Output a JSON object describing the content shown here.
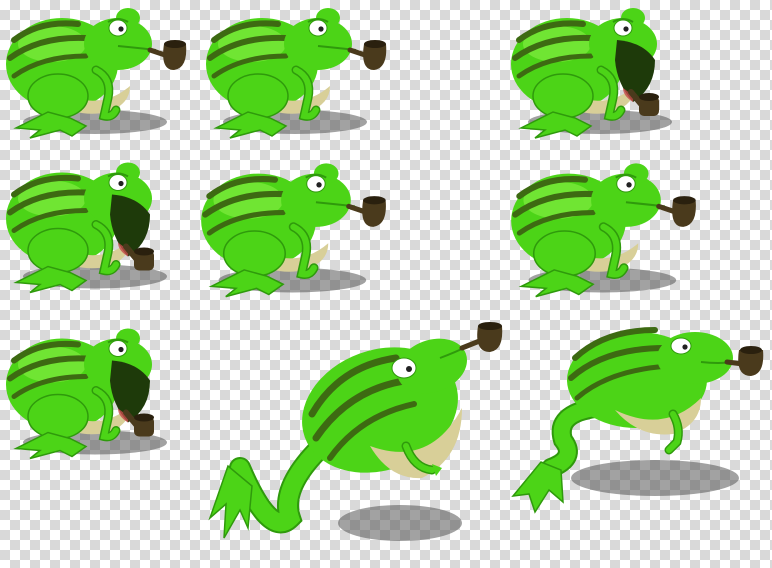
{
  "colors": {
    "skin": "#4cd417",
    "skin_light": "#8ef24a",
    "skin_dark": "#2f9a0c",
    "stripe": "#3d6a12",
    "belly": "#d8cf98",
    "belly_shade": "#b9ad72",
    "eye_white": "#ffffff",
    "pupil": "#222222",
    "mouth": "#1e3a0a",
    "pipe": "#4a3a1c",
    "pipe_rim": "#2a200e",
    "shadow": "#555555"
  },
  "sprites": [
    {
      "name": "sitting-frog-pipe-mouth",
      "pose": "sit",
      "facing": "right",
      "mouth": "closed"
    },
    {
      "name": "sitting-frog-pipe-mouth",
      "pose": "sit",
      "facing": "right",
      "mouth": "closed"
    },
    {
      "name": "sitting-frog-mouth-open",
      "pose": "sit",
      "facing": "right",
      "mouth": "open"
    },
    {
      "name": "sitting-frog-mouth-open",
      "pose": "sit",
      "facing": "right",
      "mouth": "open"
    },
    {
      "name": "sitting-frog-pipe-mouth",
      "pose": "sit",
      "facing": "right",
      "mouth": "closed"
    },
    {
      "name": "sitting-frog-pipe-mouth",
      "pose": "sit",
      "facing": "right",
      "mouth": "closed"
    },
    {
      "name": "sitting-frog-mouth-open",
      "pose": "sit",
      "facing": "right",
      "mouth": "open"
    },
    {
      "name": "leaping-frog",
      "pose": "leap",
      "facing": "right",
      "mouth": "closed"
    },
    {
      "name": "landing-frog",
      "pose": "land",
      "facing": "right",
      "mouth": "closed"
    }
  ]
}
